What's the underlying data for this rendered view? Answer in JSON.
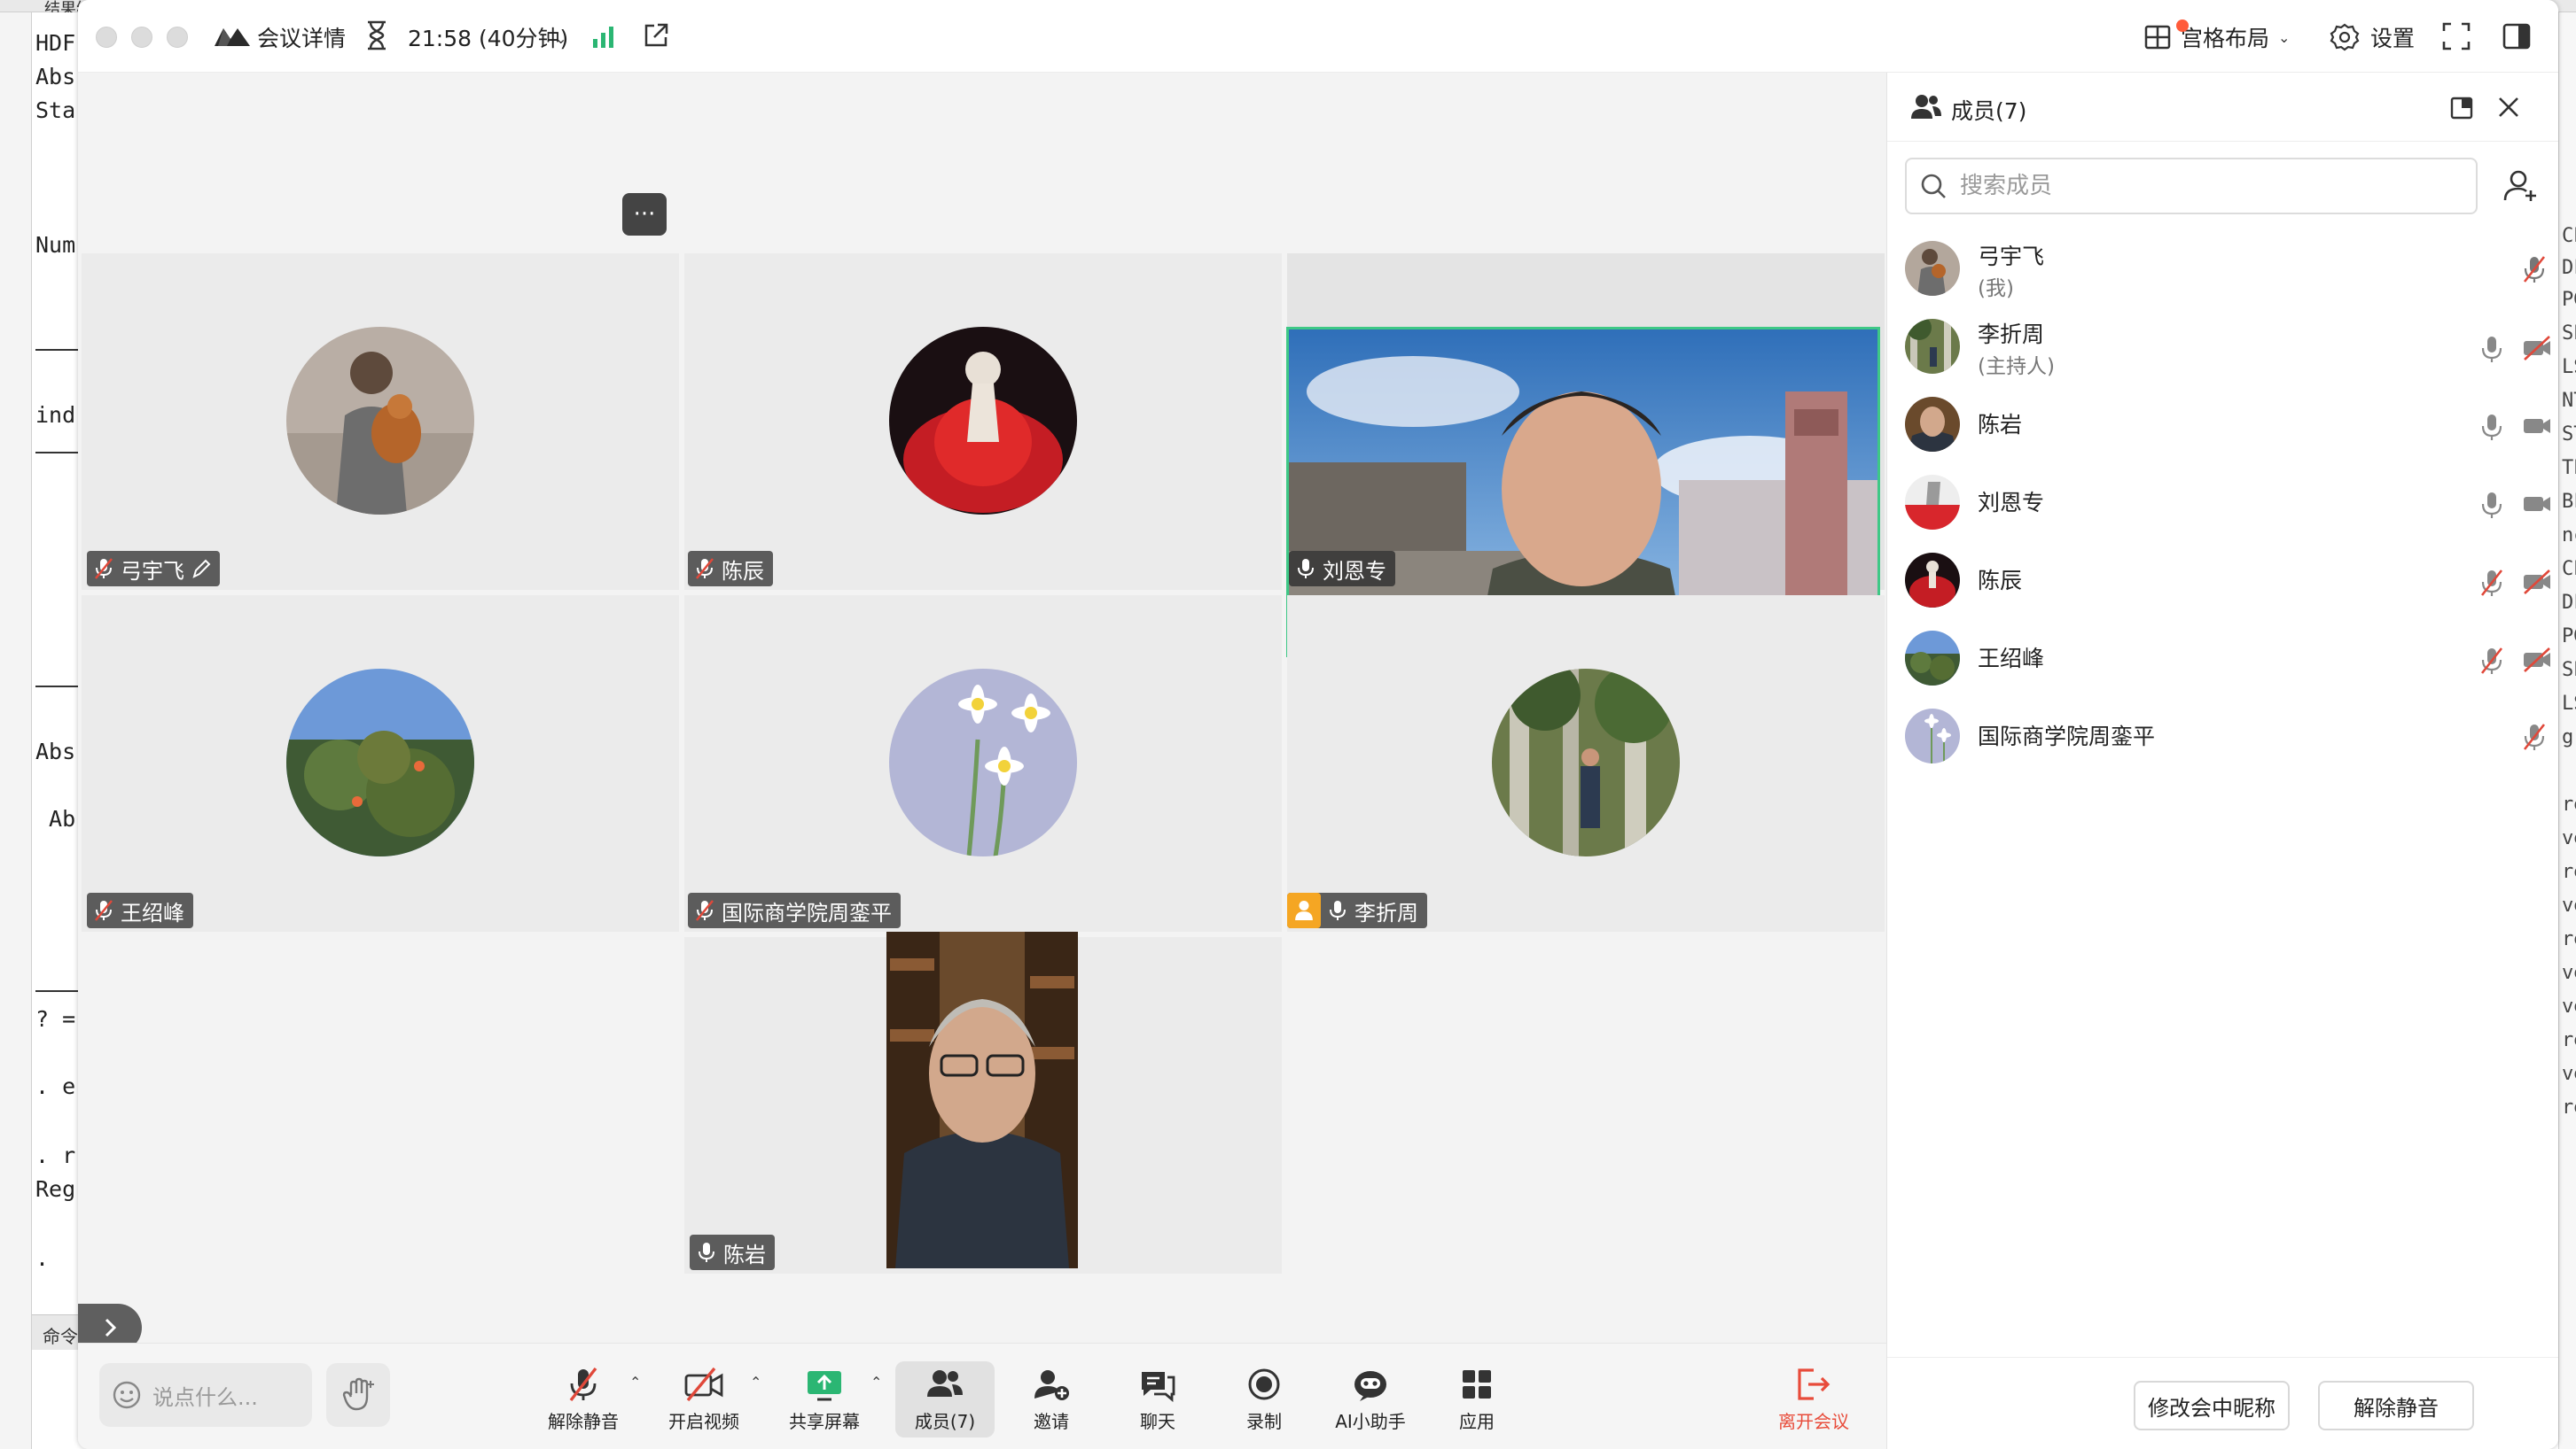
{
  "background_app": {
    "title_fragment": "结果编",
    "code_lines": [
      "HDF",
      "Abs",
      "Sta",
      "Num",
      "ind",
      "Abs",
      " Ab",
      "? =",
      ". e",
      ". r",
      "Reg",
      "."
    ],
    "command_label": "命令",
    "right_fragments": [
      "CE",
      "DF",
      "PG",
      "SE",
      "LS",
      "NT",
      "ST",
      "TE",
      "BF",
      "nc",
      "CE",
      "DF",
      "PG",
      "SE",
      "LS",
      "gre",
      "re",
      "ve",
      "re",
      "ve",
      "re",
      "ve",
      "ve",
      "re",
      "ve",
      "re"
    ]
  },
  "titlebar": {
    "meeting_details_label": "会议详情",
    "duration": "21:58 (40分钟)",
    "layout_label": "宫格布局",
    "settings_label": "设置"
  },
  "tiles": [
    {
      "name": "弓宇飞",
      "muted": true,
      "editable": true
    },
    {
      "name": "陈辰",
      "muted": true
    },
    {
      "name": "刘恩专",
      "muted": false,
      "video": true,
      "active_speaker": true
    },
    {
      "name": "王绍峰",
      "muted": true
    },
    {
      "name": "国际商学院周銮平",
      "muted": true
    },
    {
      "name": "李折周",
      "muted": false,
      "host": true
    },
    {
      "name": "陈岩",
      "muted": false,
      "video": true
    }
  ],
  "toolbar": {
    "chat_placeholder": "说点什么...",
    "unmute_label": "解除静音",
    "video_label": "开启视频",
    "share_label": "共享屏幕",
    "members_label": "成员(7)",
    "invite_label": "邀请",
    "chat_label": "聊天",
    "record_label": "录制",
    "ai_label": "AI小助手",
    "apps_label": "应用",
    "leave_label": "离开会议"
  },
  "members_panel": {
    "title": "成员(7)",
    "search_placeholder": "搜索成员",
    "members": [
      {
        "name": "弓宇飞",
        "sub": "(我)",
        "mic": "muted",
        "cam": "none"
      },
      {
        "name": "李折周",
        "sub": "(主持人)",
        "mic": "on",
        "cam": "off"
      },
      {
        "name": "陈岩",
        "sub": "",
        "mic": "on",
        "cam": "on"
      },
      {
        "name": "刘恩专",
        "sub": "",
        "mic": "on",
        "cam": "on"
      },
      {
        "name": "陈辰",
        "sub": "",
        "mic": "muted",
        "cam": "off"
      },
      {
        "name": "王绍峰",
        "sub": "",
        "mic": "muted",
        "cam": "off"
      },
      {
        "name": "国际商学院周銮平",
        "sub": "",
        "mic": "muted",
        "cam": "none"
      }
    ],
    "rename_button": "修改会中昵称",
    "unmute_button": "解除静音"
  },
  "colors": {
    "accent_green": "#3ec886",
    "host_orange": "#f5a623",
    "leave_red": "#e84b3a",
    "muted_red": "#e0483a"
  }
}
